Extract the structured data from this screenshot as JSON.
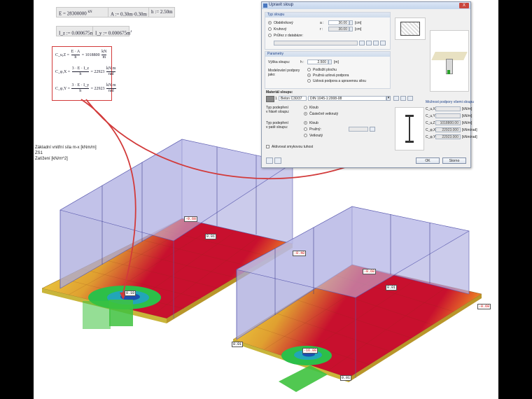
{
  "formulas": {
    "E": "E = 28300000",
    "E_unit_num": "kN",
    "E_unit_den": "m²",
    "A": "A := 0.30m·0.30m = 0.09m",
    "A_exp": "2",
    "h": "h := 2.50m",
    "Iz": "I_z := 0.000675m",
    "Iz_exp": "4",
    "Iy": "I_y := 0.000675m",
    "Iy_exp": "4"
  },
  "springs": [
    {
      "lhs": "C_u,Z =",
      "num": "E · A",
      "den": "h",
      "val": "= 1018800",
      "unit_num": "kN",
      "unit_den": "m"
    },
    {
      "lhs": "C_φ,X =",
      "num": "3 · E · I_z",
      "den": "h",
      "val": "= 22923",
      "unit_num": "kN m",
      "unit_den": "rad"
    },
    {
      "lhs": "C_φ,Y =",
      "num": "3 · E · I_y",
      "den": "h",
      "val": "= 22923",
      "unit_num": "kN m",
      "unit_den": "rad"
    }
  ],
  "legend": {
    "line1": "Základní vnitřní síla  m-x [kNm/m]",
    "line2": "ZS1",
    "line3": "Zatížení [kN/m^2]"
  },
  "dialog": {
    "title": "Upravit sloup",
    "close": "X",
    "cross_section": {
      "header": "Typ sloupu",
      "options": [
        "Obdélníkový",
        "Kruhový",
        "Průřez z databáze:"
      ],
      "selected": 0,
      "a_label": "a :",
      "a_value": "30.00",
      "a_unit": "[cm]",
      "r_label": "r :",
      "r_value": "30.00",
      "r_unit": "[cm]"
    },
    "parameters": {
      "header": "Parametry",
      "height_label": "Výška sloupu:",
      "h_label": "h :",
      "height_value": "2.500",
      "height_unit": "[m]",
      "model_label_1": "Modelování podpory",
      "model_label_2": "jako:",
      "model_options": [
        "Podložit plochu",
        "Pružná uzlová podpora",
        "Uzlová podpora a upravenou silou"
      ],
      "model_selected": 1
    },
    "material": {
      "label": "Materiál sloupu:",
      "number": "1",
      "name": "Beton C30/37",
      "norm": "DIN 1045-1:2008-08"
    },
    "support_top": {
      "label_1": "Typ podepření",
      "label_2": "v hlavě sloupu:",
      "options": [
        "Kloub",
        "Částečně vetknutý"
      ],
      "selected": 1
    },
    "support_bottom": {
      "label_1": "Typ podepření",
      "label_2": "v patě sloupu:",
      "options": [
        "Kloub",
        "Pružný:",
        "Vetknutý"
      ],
      "selected": 0
    },
    "shear_checkbox": "Aktivovat smykovou tuhost",
    "stiffness": {
      "header": "Možnost podpory všemi sloupu",
      "rows": [
        {
          "label": "C_u,X :",
          "value": "",
          "unit": "[kN/m]"
        },
        {
          "label": "C_u,Y :",
          "value": "",
          "unit": "[kN/m]"
        },
        {
          "label": "C_u,Z :",
          "value": "1018800.00",
          "unit": "[kN/m]"
        },
        {
          "label": "C_φ,X :",
          "value": "22923.000",
          "unit": "[kNm/rad]"
        },
        {
          "label": "C_φ,Y :",
          "value": "22923.000",
          "unit": "[kNm/rad]"
        }
      ]
    },
    "ok": "OK",
    "cancel": "Storno"
  },
  "model": {
    "left_labels": [
      "-0.60",
      "0.01",
      "-0.40",
      "0.10"
    ],
    "right_labels": [
      "-0.60",
      "0.01",
      "-0.69",
      "0.01",
      "-16.80",
      "0.01"
    ]
  },
  "colors": {
    "annotation_red": "#d23a3a",
    "building_fill": "#a9a9dc",
    "plate_yellow": "#f2e84a",
    "plate_red": "#c8102e",
    "plate_orange": "#f08a24",
    "column_green": "#3ec23e"
  }
}
